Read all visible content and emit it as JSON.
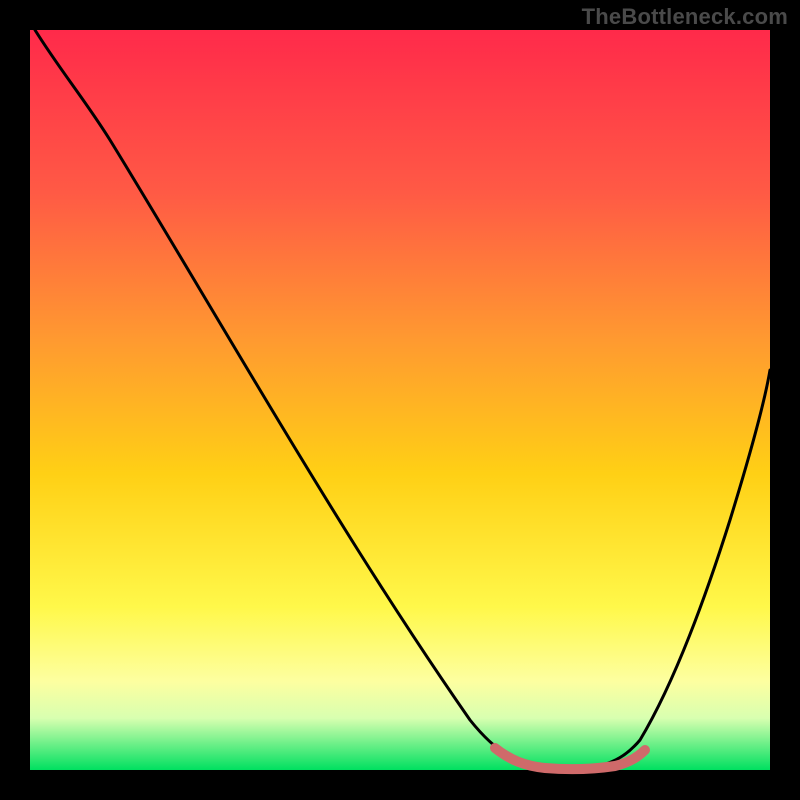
{
  "watermark": "TheBottleneck.com",
  "chart_data": {
    "type": "line",
    "title": "",
    "xlabel": "",
    "ylabel": "",
    "xlim": [
      0,
      100
    ],
    "ylim": [
      0,
      100
    ],
    "grid": false,
    "legend": false,
    "background_gradient": {
      "top": "#ff2a4a",
      "mid_upper": "#ff8040",
      "mid": "#ffd820",
      "mid_lower": "#ffff60",
      "lower_band": "#e8ffb0",
      "bottom": "#00e060"
    },
    "series": [
      {
        "name": "curve",
        "color": "#000000",
        "x": [
          5,
          10,
          15,
          20,
          25,
          30,
          35,
          40,
          45,
          50,
          55,
          60,
          63,
          66,
          70,
          74,
          78,
          82,
          86,
          90,
          95
        ],
        "y": [
          100,
          93,
          86,
          78,
          70,
          62,
          54,
          46,
          38,
          30,
          22,
          14,
          8,
          4,
          1,
          0,
          0,
          2,
          12,
          32,
          62
        ]
      },
      {
        "name": "bottom-highlight",
        "color": "#d46a6a",
        "x": [
          63,
          66,
          70,
          74,
          78,
          80
        ],
        "y": [
          4,
          2,
          0.5,
          0.5,
          1.5,
          3
        ]
      }
    ],
    "annotations": []
  }
}
